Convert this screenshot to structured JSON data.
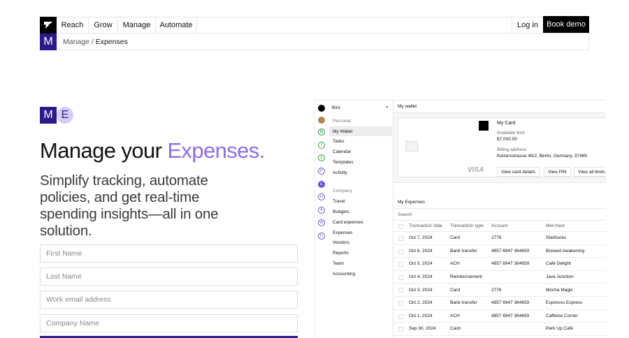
{
  "nav": {
    "links": [
      "Reach",
      "Grow",
      "Manage",
      "Automate"
    ],
    "login": "Log in",
    "demo": "Book demo",
    "badge_letter": "M",
    "breadcrumb_parent": "Manage",
    "breadcrumb_sep": "/",
    "breadcrumb_current": "Expenses"
  },
  "hero": {
    "badge_m": "M",
    "badge_e": "E",
    "title_plain": "Manage your ",
    "title_accent": "Expenses.",
    "subtitle": "Simplify tracking, automate policies, and get real-time spending insights—all in one solution.",
    "fields": [
      "First Name",
      "Last Name",
      "Work email address",
      "Company Name"
    ]
  },
  "app": {
    "workspace": "Bird",
    "sidebar": {
      "personal_label": "Personal",
      "personal_items": [
        "My Wallet",
        "Tasks",
        "Calendar",
        "Templates",
        "Activity"
      ],
      "company_label": "Company",
      "company_items": [
        "Travel",
        "Budgets",
        "Card expenses",
        "Expenses",
        "Vendors",
        "Reports",
        "Team",
        "Accounting"
      ],
      "icon_letters": [
        "M",
        "I",
        "S",
        "P",
        "E",
        "H",
        "A",
        "W",
        "D"
      ]
    },
    "wallet": {
      "title": "My wallet",
      "card_title": "My Card",
      "limit_label": "Available limit",
      "limit_value": "$7,000.00",
      "billing_label": "Billing address",
      "billing_value": "Keizersstrasse 46/2, Berlin, Germany, 37465",
      "brand": "VISA",
      "buttons": [
        "View card details",
        "View PIN",
        "View all limits"
      ]
    },
    "expenses": {
      "title": "My Expenses",
      "search": "Search",
      "columns": [
        "Transaction date",
        "Transaction type",
        "Account",
        "Merchant"
      ],
      "rows": [
        [
          "Oct 7, 2024",
          "Card",
          "2776",
          "Starbucks"
        ],
        [
          "Oct 6, 2024",
          "Bank transfer",
          "4857 6947 364659",
          "Brewed Awakening"
        ],
        [
          "Oct 5, 2024",
          "ACH",
          "4857 6947 364659",
          "Café Delight"
        ],
        [
          "Oct 4, 2024",
          "Reimbursement",
          "",
          "Java Junction"
        ],
        [
          "Oct 3, 2024",
          "Card",
          "2776",
          "Mocha Magic"
        ],
        [
          "Oct 2, 2024",
          "Bank transfer",
          "4857 6947 364659",
          "Espresso Express"
        ],
        [
          "Oct 1, 2024",
          "ACH",
          "4857 6947 364659",
          "Caffeine Corner"
        ],
        [
          "Sep 30, 2024",
          "Cash",
          "",
          "Perk Up Café"
        ]
      ]
    }
  },
  "colors": {
    "brand_purple": "#2b1a8c",
    "accent_lavender": "#8c6ee8",
    "badge_lavender": "#d8ccf5"
  }
}
